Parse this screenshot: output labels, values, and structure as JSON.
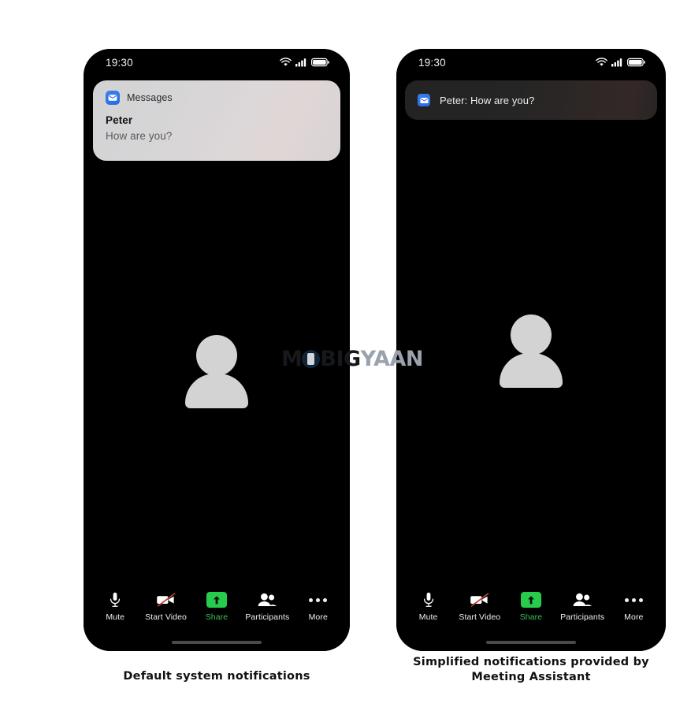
{
  "page": {
    "background_color": "#ffffff",
    "watermark": {
      "text": "MOBIGYAAN",
      "part_dark": "M",
      "part_dark2": "BIG",
      "part_light": "YAAN",
      "color_dark": "#16181c",
      "color_light": "#9aa3ad"
    }
  },
  "phones": [
    {
      "id": "left",
      "caption": "Default system notifications",
      "statusbar": {
        "time": "19:30",
        "icons": [
          "wifi-icon",
          "signal-icon",
          "battery-icon"
        ]
      },
      "notification": {
        "style": "default",
        "app_icon": "messages-icon",
        "app_name": "Messages",
        "title": "Peter",
        "body": "How are you?"
      },
      "video": {
        "avatar": "person-placeholder-avatar"
      },
      "toolbar": [
        {
          "icon": "microphone-icon",
          "label": "Mute",
          "accent": false
        },
        {
          "icon": "video-off-icon",
          "label": "Start Video",
          "accent": false
        },
        {
          "icon": "share-screen-icon",
          "label": "Share",
          "accent": true
        },
        {
          "icon": "participants-icon",
          "label": "Participants",
          "accent": false
        },
        {
          "icon": "more-icon",
          "label": "More",
          "accent": false
        }
      ]
    },
    {
      "id": "right",
      "caption_line1": "Simplified  notifications  provided  by",
      "caption_line2": "Meeting Assistant",
      "statusbar": {
        "time": "19:30",
        "icons": [
          "wifi-icon",
          "signal-icon",
          "battery-icon"
        ]
      },
      "notification": {
        "style": "simplified",
        "app_icon": "messages-icon",
        "text": "Peter: How are you?"
      },
      "video": {
        "avatar": "person-placeholder-avatar"
      },
      "toolbar": [
        {
          "icon": "microphone-icon",
          "label": "Mute",
          "accent": false
        },
        {
          "icon": "video-off-icon",
          "label": "Start Video",
          "accent": false
        },
        {
          "icon": "share-screen-icon",
          "label": "Share",
          "accent": true
        },
        {
          "icon": "participants-icon",
          "label": "Participants",
          "accent": false
        },
        {
          "icon": "more-icon",
          "label": "More",
          "accent": false
        }
      ]
    }
  ],
  "colors": {
    "share_green": "#28cc4c",
    "share_label_green": "#3ac05c",
    "video_slash_red": "#c0392b",
    "app_icon_blue": "#2b6ae0",
    "avatar_gray": "#d3d3d3"
  }
}
